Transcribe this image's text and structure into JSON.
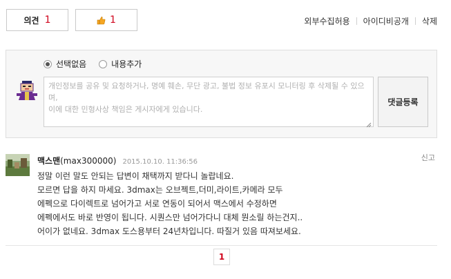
{
  "topbar": {
    "opinion_label": "의견",
    "opinion_count": "1",
    "like_count": "1",
    "links": [
      "외부수집허용",
      "아이디비공개",
      "삭제"
    ]
  },
  "write": {
    "radio_options": [
      "선택없음",
      "내용추가"
    ],
    "selected_option": "선택없음",
    "placeholder_line1": "개인정보를 공유 및 요청하거나, 명예 훼손, 무단 광고, 불법 정보 유포시 모니터링 후 삭제될 수 있으며,",
    "placeholder_line2": "이에 대한 민형사상 책임은 게시자에게 있습니다.",
    "submit_label": "댓글등록"
  },
  "comment": {
    "author_name": "맥스맨",
    "author_id": "(max300000)",
    "date": "2015.10.10. 11:36:56",
    "report_label": "신고",
    "lines": [
      "정말 이런 말도 안되는 답변이 채택까지 받다니 놀랍네요.",
      "모르면 답을 하지 마세요. 3dmax는 오브젝트,더미,라이트,카메라 모두",
      "에펙으로 다이렉트로 넘어가고 서로 연동이 되어서 맥스에서 수정하면",
      "에펙에서도 바로 반영이 됩니다. 시퀀스만 넘어가다니 대체 뭔소릴 하는건지..",
      "어이가 없네요. 3dmax 도스용부터 24년차입니다. 따질거 있음 따져보세요."
    ]
  },
  "pagination": {
    "current": "1"
  },
  "colors": {
    "accent_red": "#d0021b"
  }
}
